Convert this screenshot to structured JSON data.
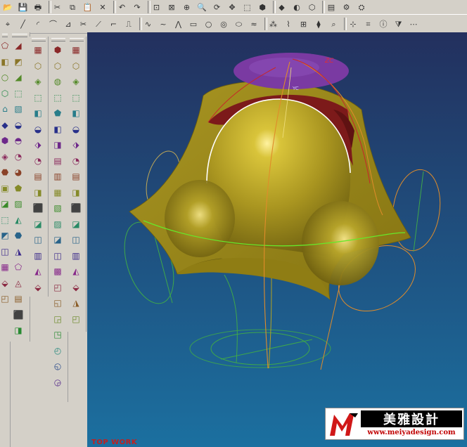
{
  "toolbar_top": {
    "buttons": [
      {
        "name": "open-icon",
        "glyph": "📂"
      },
      {
        "name": "save-icon",
        "glyph": "💾"
      },
      {
        "name": "print-icon",
        "glyph": "🖶"
      },
      {
        "name": "cut-icon",
        "glyph": "✂"
      },
      {
        "name": "copy-icon",
        "glyph": "⧉"
      },
      {
        "name": "paste-icon",
        "glyph": "📋"
      },
      {
        "name": "delete-icon",
        "glyph": "✕"
      },
      {
        "name": "undo-icon",
        "glyph": "↶"
      },
      {
        "name": "redo-icon",
        "glyph": "↷"
      },
      {
        "name": "zoom-fit-icon",
        "glyph": "⊡"
      },
      {
        "name": "zoom-window-icon",
        "glyph": "⊠"
      },
      {
        "name": "zoom-in-icon",
        "glyph": "⊕"
      },
      {
        "name": "zoom-icon",
        "glyph": "🔍"
      },
      {
        "name": "rotate-icon",
        "glyph": "⟳"
      },
      {
        "name": "pan-icon",
        "glyph": "✥"
      },
      {
        "name": "view-box-icon",
        "glyph": "⬚"
      },
      {
        "name": "view-orient-icon",
        "glyph": "⬢"
      },
      {
        "name": "shading-icon",
        "glyph": "◆"
      },
      {
        "name": "render-icon",
        "glyph": "◐"
      },
      {
        "name": "wireframe-icon",
        "glyph": "⬡"
      },
      {
        "name": "layer-icon",
        "glyph": "▤"
      },
      {
        "name": "part-nav-icon",
        "glyph": "⚙"
      },
      {
        "name": "assembly-icon",
        "glyph": "⛭"
      }
    ]
  },
  "toolbar_sketch": {
    "buttons": [
      {
        "name": "point-icon",
        "glyph": "⌖"
      },
      {
        "name": "line-icon",
        "glyph": "╱"
      },
      {
        "name": "arc-icon",
        "glyph": "◜"
      },
      {
        "name": "fillet-icon",
        "glyph": "⌒"
      },
      {
        "name": "offset-icon",
        "glyph": "⊿"
      },
      {
        "name": "trim-icon",
        "glyph": "✂"
      },
      {
        "name": "extend-icon",
        "glyph": "⟋"
      },
      {
        "name": "corner-icon",
        "glyph": "⌐"
      },
      {
        "name": "mirror-icon",
        "glyph": "⎍"
      },
      {
        "name": "curve-icon",
        "glyph": "∿"
      },
      {
        "name": "spline-icon",
        "glyph": "~"
      },
      {
        "name": "polyline-icon",
        "glyph": "⋀"
      },
      {
        "name": "rectangle-icon",
        "glyph": "▭"
      },
      {
        "name": "circle-icon",
        "glyph": "○"
      },
      {
        "name": "circle-center-icon",
        "glyph": "◎"
      },
      {
        "name": "ellipse-icon",
        "glyph": "⬭"
      },
      {
        "name": "wave-icon",
        "glyph": "≈"
      },
      {
        "name": "pattern-icon",
        "glyph": "⁂"
      },
      {
        "name": "blend-icon",
        "glyph": "⌇"
      },
      {
        "name": "section-icon",
        "glyph": "⊞"
      },
      {
        "name": "edit-curve-icon",
        "glyph": "⧫"
      },
      {
        "name": "analyze-icon",
        "glyph": "⌕"
      },
      {
        "name": "snap-icon",
        "glyph": "⊹"
      },
      {
        "name": "measure-icon",
        "glyph": "⌗"
      },
      {
        "name": "info-icon",
        "glyph": "ⓘ"
      },
      {
        "name": "filter-icon",
        "glyph": "⧩"
      },
      {
        "name": "more-icon",
        "glyph": "⋯"
      }
    ]
  },
  "palette_col1": [
    "⬠",
    "◧",
    "○",
    "⬡",
    "⌂",
    "◆",
    "⬢",
    "◈",
    "⬣",
    "▣",
    "◪",
    "⬚",
    "◩",
    "◫",
    "▦",
    "⬙",
    "◰"
  ],
  "palette_col2": [
    "◢",
    "◩",
    "◢",
    "⬚",
    "▧",
    "◒",
    "◓",
    "◔",
    "◕",
    "⬟",
    "▨",
    "◭",
    "⬣",
    "◮",
    "⬠",
    "◬",
    "▤",
    "⬛",
    "◨",
    "◧",
    "⬗",
    "▥",
    "⬘",
    "◐"
  ],
  "palette_col3": [
    "▦",
    "⬡",
    "◈",
    "⬚",
    "◧",
    "◒",
    "⬗",
    "◔",
    "▤",
    "◨",
    "⬛",
    "◪",
    "◫",
    "▥",
    "◭",
    "⬙",
    "◮",
    "◰",
    "◱",
    "◲",
    "◳",
    "◴",
    "◵",
    "◶",
    "◷"
  ],
  "palette_col4": [
    "⬢",
    "⬡",
    "◍",
    "⬚",
    "⬟",
    "◧",
    "◨",
    "▤",
    "▥",
    "▦",
    "▧",
    "▨",
    "◪",
    "◫",
    "▩",
    "◰",
    "◱",
    "◲",
    "◳",
    "◴",
    "◵",
    "◶",
    "◷",
    "▣",
    "▢"
  ],
  "viewport": {
    "view_label": "TOP WORK",
    "axis_label": "ZC",
    "axis_label_small": "YC",
    "background_top": "#24305e",
    "background_bottom": "#1d6a9a",
    "surface_color": "#b5a221",
    "top_cap_color": "#7a3aa2",
    "inner_color": "#8a1c1c"
  },
  "logo": {
    "name": "美雅設計",
    "url": "www.meiyadesign.com",
    "mark_color": "#d01818"
  }
}
